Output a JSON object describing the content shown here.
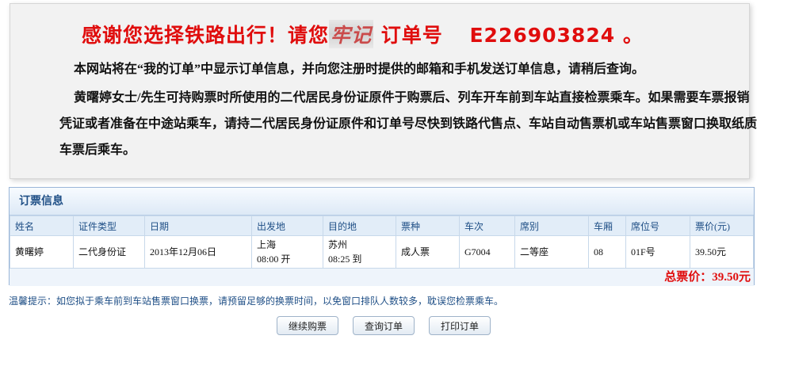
{
  "notice": {
    "headline_prefix": "感谢您选择铁路出行！请您",
    "headline_remember": "牢记",
    "headline_suffix": "订单号",
    "order_number": "E226903824",
    "headline_end": "。",
    "para1": "本网站将在“我的订单”中显示订单信息，并向您注册时提供的邮箱和手机发送订单信息，请稍后查询。",
    "para2": "黄曙婷女士/先生可持购票时所使用的二代居民身份证原件于购票后、列车开车前到车站直接检票乘车。如果需要车票报销凭证或者准备在中途站乘车，请持二代居民身份证原件和订单号尽快到铁路代售点、车站自动售票机或车站售票窗口换取纸质车票后乘车。"
  },
  "ticket_panel": {
    "title": "订票信息",
    "columns": [
      "姓名",
      "证件类型",
      "日期",
      "出发地",
      "目的地",
      "票种",
      "车次",
      "席别",
      "车厢",
      "席位号",
      "票价(元)"
    ],
    "rows": [
      {
        "name": "黄曙婷",
        "id_type": "二代身份证",
        "date": "2013年12月06日",
        "from_station": "上海",
        "from_time": "08:00 开",
        "to_station": "苏州",
        "to_time": "08:25 到",
        "ticket_type": "成人票",
        "train_no": "G7004",
        "seat_class": "二等座",
        "coach": "08",
        "seat_no": "01F号",
        "price": "39.50元"
      }
    ],
    "total_label": "总票价：",
    "total_value": "39.50元"
  },
  "tip": "温馨提示：如您拟于乘车前到车站售票窗口换票，请预留足够的换票时间，以免窗口排队人数较多，耽误您检票乘车。",
  "buttons": {
    "continue": "继续购票",
    "query": "查询订单",
    "print": "打印订单"
  }
}
